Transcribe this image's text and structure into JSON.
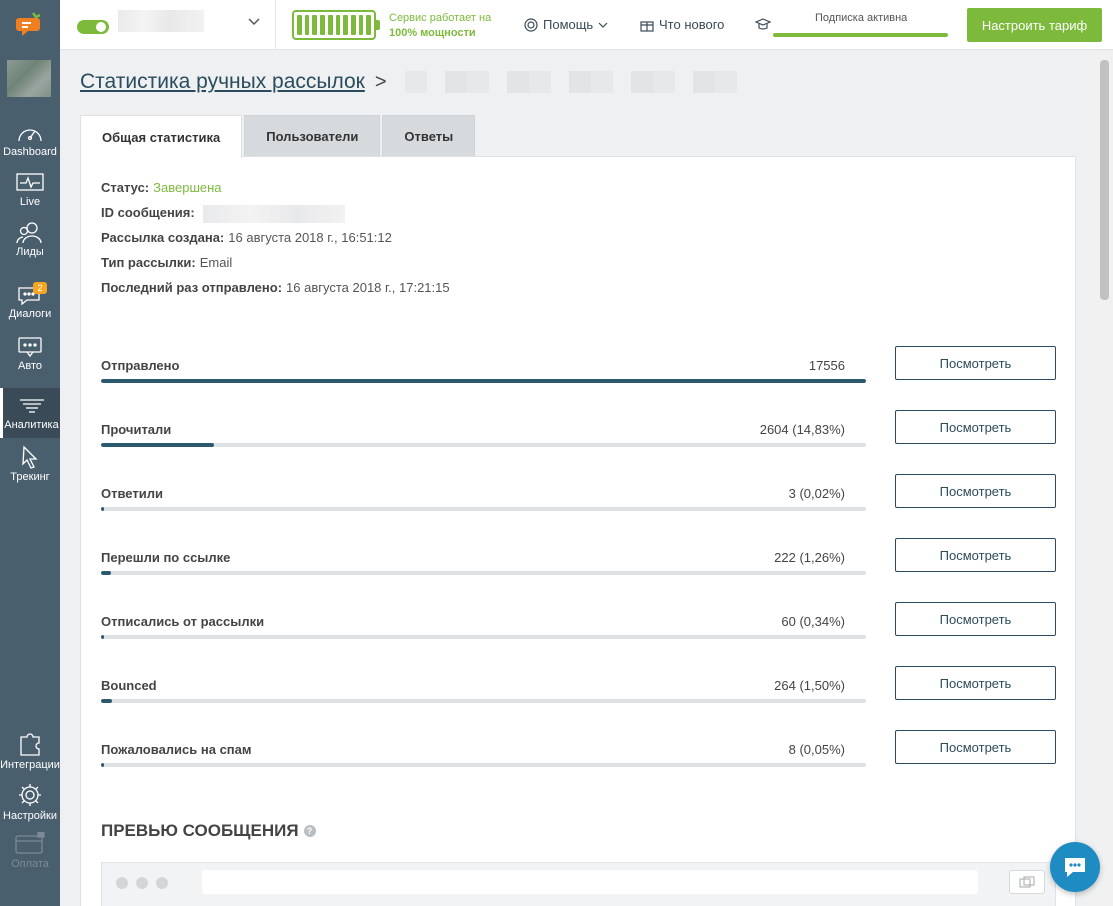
{
  "sidebar": {
    "items": [
      {
        "label": "Dashboard",
        "icon": "speedometer-icon"
      },
      {
        "label": "Live",
        "icon": "pulse-icon"
      },
      {
        "label": "Лиды",
        "icon": "users-icon"
      },
      {
        "label": "Диалоги",
        "icon": "chat-icon",
        "badge": "2"
      },
      {
        "label": "Авто",
        "icon": "auto-message-icon"
      },
      {
        "label": "Аналитика",
        "icon": "analytics-icon"
      },
      {
        "label": "Трекинг",
        "icon": "cursor-icon"
      },
      {
        "label": "Интеграции",
        "icon": "puzzle-icon"
      },
      {
        "label": "Настройки",
        "icon": "gear-icon"
      },
      {
        "label": "Оплата",
        "icon": "card-icon"
      }
    ]
  },
  "topbar": {
    "service_line1": "Сервис работает на",
    "service_line2": "100% мощности",
    "help_label": "Помощь",
    "whats_new_label": "Что нового",
    "subscription_label": "Подписка активна",
    "plan_button": "Настроить тариф",
    "accent_color": "#7dba3c"
  },
  "breadcrumb": {
    "link": "Статистика ручных рассылок",
    "separator": ">"
  },
  "tabs": [
    {
      "label": "Общая статистика",
      "active": true
    },
    {
      "label": "Пользователи",
      "active": false
    },
    {
      "label": "Ответы",
      "active": false
    }
  ],
  "info": {
    "status_label": "Статус:",
    "status_value": "Завершена",
    "id_label": "ID сообщения:",
    "created_label": "Рассылка создана:",
    "created_value": "16 августа 2018 г., 16:51:12",
    "type_label": "Тип рассылки:",
    "type_value": "Email",
    "last_sent_label": "Последний раз отправлено:",
    "last_sent_value": "16 августа 2018 г., 17:21:15"
  },
  "stats": [
    {
      "label": "Отправлено",
      "value": "17556",
      "percent": 100,
      "button": "Посмотреть"
    },
    {
      "label": "Прочитали",
      "value": "2604 (14,83%)",
      "percent": 14.83,
      "button": "Посмотреть"
    },
    {
      "label": "Ответили",
      "value": "3 (0,02%)",
      "percent": 0.02,
      "button": "Посмотреть"
    },
    {
      "label": "Перешли по ссылке",
      "value": "222 (1,26%)",
      "percent": 1.26,
      "button": "Посмотреть"
    },
    {
      "label": "Отписались от рассылки",
      "value": "60 (0,34%)",
      "percent": 0.34,
      "button": "Посмотреть"
    },
    {
      "label": "Bounced",
      "value": "264 (1,50%)",
      "percent": 1.5,
      "button": "Посмотреть"
    },
    {
      "label": "Пожаловались на спам",
      "value": "8 (0,05%)",
      "percent": 0.05,
      "button": "Посмотреть"
    }
  ],
  "preview": {
    "title": "ПРЕВЬЮ СООБЩЕНИЯ",
    "help": "?"
  }
}
